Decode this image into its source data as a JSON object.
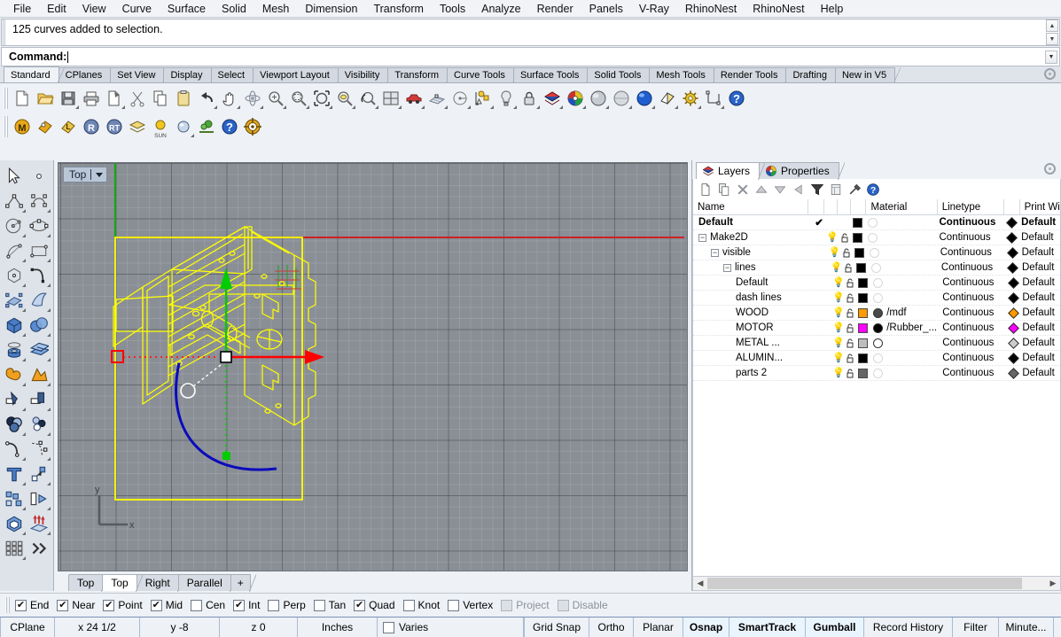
{
  "menubar": {
    "items": [
      {
        "label": "File"
      },
      {
        "label": "Edit"
      },
      {
        "label": "View"
      },
      {
        "label": "Curve"
      },
      {
        "label": "Surface"
      },
      {
        "label": "Solid"
      },
      {
        "label": "Mesh"
      },
      {
        "label": "Dimension"
      },
      {
        "label": "Transform"
      },
      {
        "label": "Tools"
      },
      {
        "label": "Analyze"
      },
      {
        "label": "Render"
      },
      {
        "label": "Panels"
      },
      {
        "label": "V-Ray"
      },
      {
        "label": "RhinoNest"
      },
      {
        "label": "RhinoNest"
      },
      {
        "label": "Help"
      }
    ]
  },
  "command": {
    "history": "125 curves added to selection.",
    "prompt_label": "Command:",
    "input_value": ""
  },
  "toolbar_tabs": {
    "active": "Standard",
    "items": [
      {
        "label": "Standard"
      },
      {
        "label": "CPlanes"
      },
      {
        "label": "Set View"
      },
      {
        "label": "Display"
      },
      {
        "label": "Select"
      },
      {
        "label": "Viewport Layout"
      },
      {
        "label": "Visibility"
      },
      {
        "label": "Transform"
      },
      {
        "label": "Curve Tools"
      },
      {
        "label": "Surface Tools"
      },
      {
        "label": "Solid Tools"
      },
      {
        "label": "Mesh Tools"
      },
      {
        "label": "Render Tools"
      },
      {
        "label": "Drafting"
      },
      {
        "label": "New in V5"
      }
    ]
  },
  "standard_toolbar": {
    "buttons": [
      {
        "name": "new-file-icon"
      },
      {
        "name": "open-file-icon"
      },
      {
        "name": "save-file-icon"
      },
      {
        "name": "print-icon"
      },
      {
        "name": "cut-paste-icon"
      },
      {
        "name": "cut-scissors-icon"
      },
      {
        "name": "copy-icon"
      },
      {
        "name": "paste-icon"
      },
      {
        "name": "undo-icon"
      },
      {
        "name": "pan-hand-icon"
      },
      {
        "name": "rotate-view-icon"
      },
      {
        "name": "zoom-in-icon"
      },
      {
        "name": "zoom-window-icon"
      },
      {
        "name": "zoom-extents-icon"
      },
      {
        "name": "zoom-selected-icon"
      },
      {
        "name": "zoom-previous-icon"
      },
      {
        "name": "viewport-layout-icon"
      },
      {
        "name": "render-car-icon"
      },
      {
        "name": "cplane-grid-icon"
      },
      {
        "name": "named-view-icon"
      },
      {
        "name": "object-snap-icon"
      },
      {
        "name": "light-bulb-icon"
      },
      {
        "name": "lock-icon"
      },
      {
        "name": "layers-icon"
      },
      {
        "name": "color-wheel-icon"
      },
      {
        "name": "shaded-sphere-icon"
      },
      {
        "name": "ghosted-sphere-icon"
      },
      {
        "name": "rendered-sphere-icon"
      },
      {
        "name": "flat-shade-icon"
      },
      {
        "name": "options-gear-icon"
      },
      {
        "name": "dimension-icon"
      },
      {
        "name": "help-icon"
      }
    ]
  },
  "plugin_toolbar": {
    "buttons": [
      {
        "name": "vray-m-icon"
      },
      {
        "name": "vray-o-icon"
      },
      {
        "name": "vray-l-icon"
      },
      {
        "name": "vray-render-icon"
      },
      {
        "name": "vray-rt-icon"
      },
      {
        "name": "vray-layers-icon"
      },
      {
        "name": "sun-icon",
        "label": "SUN"
      },
      {
        "name": "vray-sphere-icon"
      },
      {
        "name": "vray-trees-icon"
      },
      {
        "name": "vray-help-icon"
      },
      {
        "name": "vray-target-icon"
      }
    ]
  },
  "left_toolbar": {
    "buttons": [
      {
        "name": "select-arrow-icon"
      },
      {
        "name": "point-icon"
      },
      {
        "name": "polyline-icon"
      },
      {
        "name": "curve-control-points-icon"
      },
      {
        "name": "circle-icon"
      },
      {
        "name": "ellipse-icon"
      },
      {
        "name": "arc-icon"
      },
      {
        "name": "rectangle-icon"
      },
      {
        "name": "polygon-icon"
      },
      {
        "name": "curve-tools-icon"
      },
      {
        "name": "surface-from-points-icon"
      },
      {
        "name": "surface-extrude-icon"
      },
      {
        "name": "box-icon"
      },
      {
        "name": "sphere-icon"
      },
      {
        "name": "cylinder-icon"
      },
      {
        "name": "surface-tools-icon"
      },
      {
        "name": "boolean-icon"
      },
      {
        "name": "mesh-tools-icon"
      },
      {
        "name": "trim-icon"
      },
      {
        "name": "split-icon"
      },
      {
        "name": "render-materials-icon"
      },
      {
        "name": "render-lights-icon"
      },
      {
        "name": "fillet-icon"
      },
      {
        "name": "dimension-tools-icon"
      },
      {
        "name": "text-icon"
      },
      {
        "name": "transform-icon"
      },
      {
        "name": "block-icon"
      },
      {
        "name": "array-icon"
      },
      {
        "name": "solid-tools-icon"
      },
      {
        "name": "extrude-icon"
      },
      {
        "name": "grid-panel-icon"
      },
      {
        "name": "more-chevrons-icon"
      }
    ]
  },
  "viewport": {
    "label": "Top",
    "axis_x_label": "x",
    "axis_y_label": "y",
    "tabs": [
      {
        "label": "Top",
        "active": false
      },
      {
        "label": "Top",
        "active": true
      },
      {
        "label": "Right",
        "active": false
      },
      {
        "label": "Parallel",
        "active": false
      },
      {
        "label": "+",
        "active": false
      }
    ],
    "colors": {
      "background": "#8a8f96",
      "selected_curve": "#ffff00",
      "gumball_x_axis": "#ff0000",
      "gumball_y_axis": "#00cc00",
      "gumball_arc": "#0000cc",
      "construction_plane_x": "#cc2222",
      "construction_plane_y": "#22aa22"
    }
  },
  "panel": {
    "tabs": [
      {
        "label": "Layers",
        "icon": "layers-icon",
        "active": true
      },
      {
        "label": "Properties",
        "icon": "properties-icon",
        "active": false
      }
    ],
    "toolbar_buttons": [
      {
        "name": "new-layer-icon"
      },
      {
        "name": "duplicate-layer-icon"
      },
      {
        "name": "delete-layer-icon"
      },
      {
        "name": "move-up-icon"
      },
      {
        "name": "move-down-icon"
      },
      {
        "name": "previous-icon"
      },
      {
        "name": "filter-icon"
      },
      {
        "name": "layer-properties-icon"
      },
      {
        "name": "tools-hammer-icon"
      },
      {
        "name": "help-icon"
      }
    ],
    "columns": [
      {
        "label": "Name"
      },
      {
        "label": ""
      },
      {
        "label": ""
      },
      {
        "label": ""
      },
      {
        "label": ""
      },
      {
        "label": "Material"
      },
      {
        "label": "Linetype"
      },
      {
        "label": ""
      },
      {
        "label": "Print Width"
      }
    ],
    "layers": [
      {
        "name": "Default",
        "indent": 0,
        "expander": "none",
        "current": true,
        "on": false,
        "lock": false,
        "color": "#000000",
        "material_color": "#ffffff",
        "material_filled": false,
        "material_name": "",
        "linetype": "Continuous",
        "print_color": "#000000",
        "print_width": "Default",
        "bold": true
      },
      {
        "name": "Make2D",
        "indent": 0,
        "expander": "minus",
        "current": false,
        "on": true,
        "lock": false,
        "color": "#000000",
        "material_color": "#ffffff",
        "material_filled": false,
        "material_name": "",
        "linetype": "Continuous",
        "print_color": "#000000",
        "print_width": "Default",
        "bold": false
      },
      {
        "name": "visible",
        "indent": 1,
        "expander": "minus",
        "current": false,
        "on": true,
        "lock": false,
        "color": "#000000",
        "material_color": "#ffffff",
        "material_filled": false,
        "material_name": "",
        "linetype": "Continuous",
        "print_color": "#000000",
        "print_width": "Default",
        "bold": false
      },
      {
        "name": "lines",
        "indent": 2,
        "expander": "minus",
        "current": false,
        "on": true,
        "lock": false,
        "color": "#000000",
        "material_color": "#ffffff",
        "material_filled": false,
        "material_name": "",
        "linetype": "Continuous",
        "print_color": "#000000",
        "print_width": "Default",
        "bold": false
      },
      {
        "name": "Default",
        "indent": 3,
        "expander": "none",
        "current": false,
        "on": true,
        "lock": false,
        "color": "#000000",
        "material_color": "#ffffff",
        "material_filled": false,
        "material_name": "",
        "linetype": "Continuous",
        "print_color": "#000000",
        "print_width": "Default",
        "bold": false
      },
      {
        "name": "dash lines",
        "indent": 3,
        "expander": "none",
        "current": false,
        "on": true,
        "lock": false,
        "color": "#000000",
        "material_color": "#ffffff",
        "material_filled": false,
        "material_name": "",
        "linetype": "Continuous",
        "print_color": "#000000",
        "print_width": "Default",
        "bold": false
      },
      {
        "name": "WOOD",
        "indent": 3,
        "expander": "none",
        "current": false,
        "on": true,
        "lock": false,
        "color": "#ff9900",
        "material_color": "#4a4a4a",
        "material_filled": true,
        "material_name": "/mdf",
        "linetype": "Continuous",
        "print_color": "#ff9900",
        "print_width": "Default",
        "bold": false
      },
      {
        "name": "MOTOR",
        "indent": 3,
        "expander": "none",
        "current": false,
        "on": true,
        "lock": false,
        "color": "#ff00ff",
        "material_color": "#000000",
        "material_filled": true,
        "material_name": "/Rubber_...",
        "linetype": "Continuous",
        "print_color": "#ff00ff",
        "print_width": "Default",
        "bold": false
      },
      {
        "name": "METAL ...",
        "indent": 3,
        "expander": "none",
        "current": false,
        "on": true,
        "lock": false,
        "color": "#bdbdbd",
        "material_color": "#ffffff",
        "material_filled": true,
        "material_name": "",
        "linetype": "Continuous",
        "print_color": "#cccccc",
        "print_width": "Default",
        "bold": false
      },
      {
        "name": "ALUMIN...",
        "indent": 3,
        "expander": "none",
        "current": false,
        "on": true,
        "lock": false,
        "color": "#000000",
        "material_color": "#ffffff",
        "material_filled": false,
        "material_name": "",
        "linetype": "Continuous",
        "print_color": "#000000",
        "print_width": "Default",
        "bold": false
      },
      {
        "name": "parts 2",
        "indent": 3,
        "expander": "none",
        "current": false,
        "on": true,
        "lock": false,
        "color": "#666666",
        "material_color": "#ffffff",
        "material_filled": false,
        "material_name": "",
        "linetype": "Continuous",
        "print_color": "#666666",
        "print_width": "Default",
        "bold": false
      }
    ]
  },
  "osnap": {
    "items": [
      {
        "label": "End",
        "checked": true,
        "disabled": false
      },
      {
        "label": "Near",
        "checked": true,
        "disabled": false
      },
      {
        "label": "Point",
        "checked": true,
        "disabled": false
      },
      {
        "label": "Mid",
        "checked": true,
        "disabled": false
      },
      {
        "label": "Cen",
        "checked": false,
        "disabled": false
      },
      {
        "label": "Int",
        "checked": true,
        "disabled": false
      },
      {
        "label": "Perp",
        "checked": false,
        "disabled": false
      },
      {
        "label": "Tan",
        "checked": false,
        "disabled": false
      },
      {
        "label": "Quad",
        "checked": true,
        "disabled": false
      },
      {
        "label": "Knot",
        "checked": false,
        "disabled": false
      },
      {
        "label": "Vertex",
        "checked": false,
        "disabled": false
      },
      {
        "label": "Project",
        "checked": false,
        "disabled": true
      },
      {
        "label": "Disable",
        "checked": false,
        "disabled": true
      }
    ]
  },
  "statusbar": {
    "cplane": "CPlane",
    "x": "x 24 1/2",
    "y": "y -8",
    "z": "z 0",
    "units": "Inches",
    "layer": "Varies",
    "toggles": [
      {
        "label": "Grid Snap",
        "on": false
      },
      {
        "label": "Ortho",
        "on": false
      },
      {
        "label": "Planar",
        "on": false
      },
      {
        "label": "Osnap",
        "on": true
      },
      {
        "label": "SmartTrack",
        "on": true
      },
      {
        "label": "Gumball",
        "on": true
      },
      {
        "label": "Record History",
        "on": false
      },
      {
        "label": "Filter",
        "on": false
      },
      {
        "label": "Minute...",
        "on": false
      }
    ]
  }
}
